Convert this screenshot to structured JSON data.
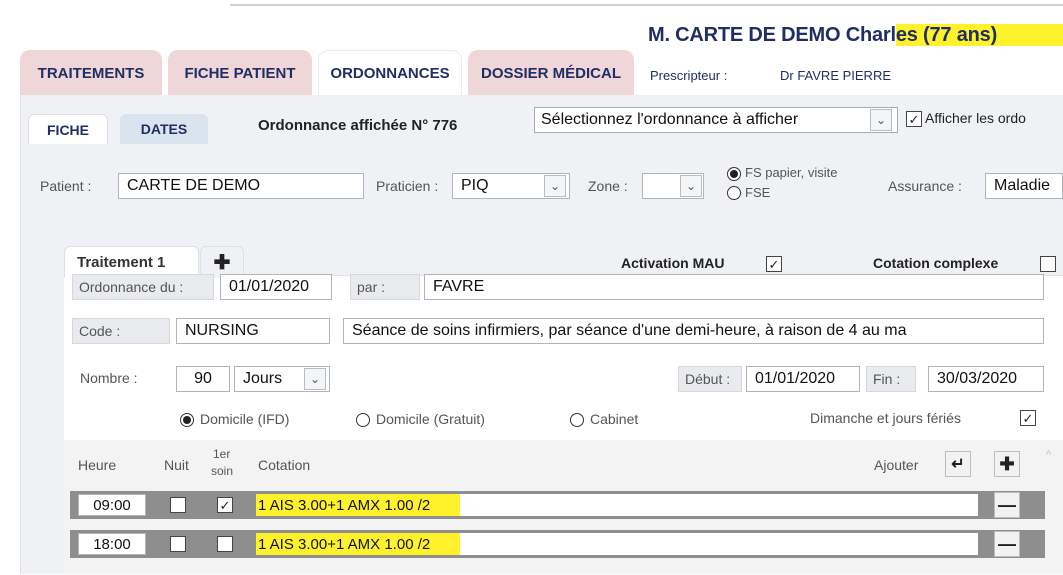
{
  "header": {
    "patient_name_prefix": "M. CARTE DE DEMO Charl",
    "patient_name_hl": "es (77 ans)",
    "prescriptor_label": "Prescripteur :",
    "prescriptor_value": "Dr FAVRE PIERRE"
  },
  "tabs": [
    {
      "label": "TRAITEMENTS"
    },
    {
      "label": "FICHE PATIENT"
    },
    {
      "label": "ORDONNANCES"
    },
    {
      "label": "DOSSIER MÉDICAL"
    }
  ],
  "subtabs": [
    {
      "label": "FICHE"
    },
    {
      "label": "DATES"
    }
  ],
  "ordonnance": {
    "displayed_label": "Ordonnance affichée N° 776",
    "select_value": "Sélectionnez l'ordonnance à afficher",
    "show_all_label": "Afficher les ordo"
  },
  "patient_row": {
    "patient_label": "Patient :",
    "patient_value": "CARTE DE DEMO",
    "praticien_label": "Praticien :",
    "praticien_value": "PIQ",
    "zone_label": "Zone :",
    "zone_value": "",
    "fs_label": "FS papier, visite",
    "fse_label": "FSE",
    "assurance_label": "Assurance :",
    "assurance_value": "Maladie"
  },
  "treatment": {
    "tab_label": "Traitement 1",
    "add_tab_icon": "plus-icon",
    "activation_mau_label": "Activation MAU",
    "activation_mau_checked": true,
    "cotation_complexe_label": "Cotation complexe",
    "cotation_complexe_checked": false,
    "ordonnance_du_label": "Ordonnance du :",
    "ordonnance_du_value": "01/01/2020",
    "par_label": "par :",
    "par_value": "FAVRE",
    "code_label": "Code :",
    "code_value": "NURSING",
    "code_description": "Séance de soins infirmiers, par séance d'une demi-heure, à raison de 4 au ma",
    "nombre_label": "Nombre :",
    "nombre_value": "90",
    "unite_value": "Jours",
    "debut_label": "Début :",
    "debut_value": "01/01/2020",
    "fin_label": "Fin :",
    "fin_value": "30/03/2020",
    "lieu_options": [
      {
        "label": "Domicile (IFD)",
        "selected": true
      },
      {
        "label": "Domicile (Gratuit)",
        "selected": false
      },
      {
        "label": "Cabinet",
        "selected": false
      }
    ],
    "dimanche_label": "Dimanche et jours fériés",
    "dimanche_checked": true
  },
  "grid": {
    "headers": {
      "heure": "Heure",
      "nuit": "Nuit",
      "first_soin_1": "1er",
      "first_soin_2": "soin",
      "cotation": "Cotation",
      "ajouter": "Ajouter"
    },
    "rows": [
      {
        "heure": "09:00",
        "nuit": false,
        "premier_soin": true,
        "cotation": "1 AIS 3.00+1 AMX  1.00 /2"
      },
      {
        "heure": "18:00",
        "nuit": false,
        "premier_soin": false,
        "cotation": "1 AIS 3.00+1 AMX  1.00 /2"
      }
    ]
  },
  "colors": {
    "tab_pink": "#efd6d8",
    "navy_text": "#1f2f63",
    "highlight": "#fff22a",
    "row_bar": "#8e8e8e"
  }
}
